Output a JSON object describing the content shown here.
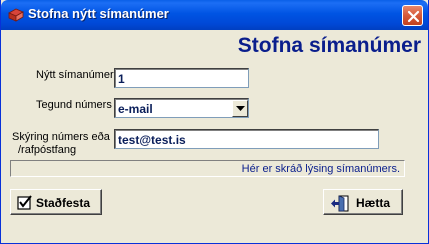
{
  "window": {
    "title": "Stofna nýtt símanúmer",
    "heading": "Stofna símanúmer"
  },
  "form": {
    "number_label": "Nýtt símanúmer",
    "number_value": "1",
    "type_label": "Tegund númers",
    "type_value": "e-mail",
    "description_label_line1": "Skýring númers eða",
    "description_label_line2": "/rafpóstfang",
    "description_value": "test@test.is"
  },
  "status": {
    "text": "Hér er skráð lýsing símanúmers."
  },
  "buttons": {
    "save_label": "Staðfesta",
    "cancel_label": "Hætta"
  },
  "icons": {
    "title": "app-icon",
    "close": "close-icon",
    "dropdown": "chevron-down-icon",
    "save": "checkbox-check-icon",
    "cancel": "exit-door-icon"
  },
  "colors": {
    "title_bar": "#0054e3",
    "heading": "#0a1e8c",
    "dialog_background": "#ece9d8",
    "close_button": "#d65a3a"
  }
}
